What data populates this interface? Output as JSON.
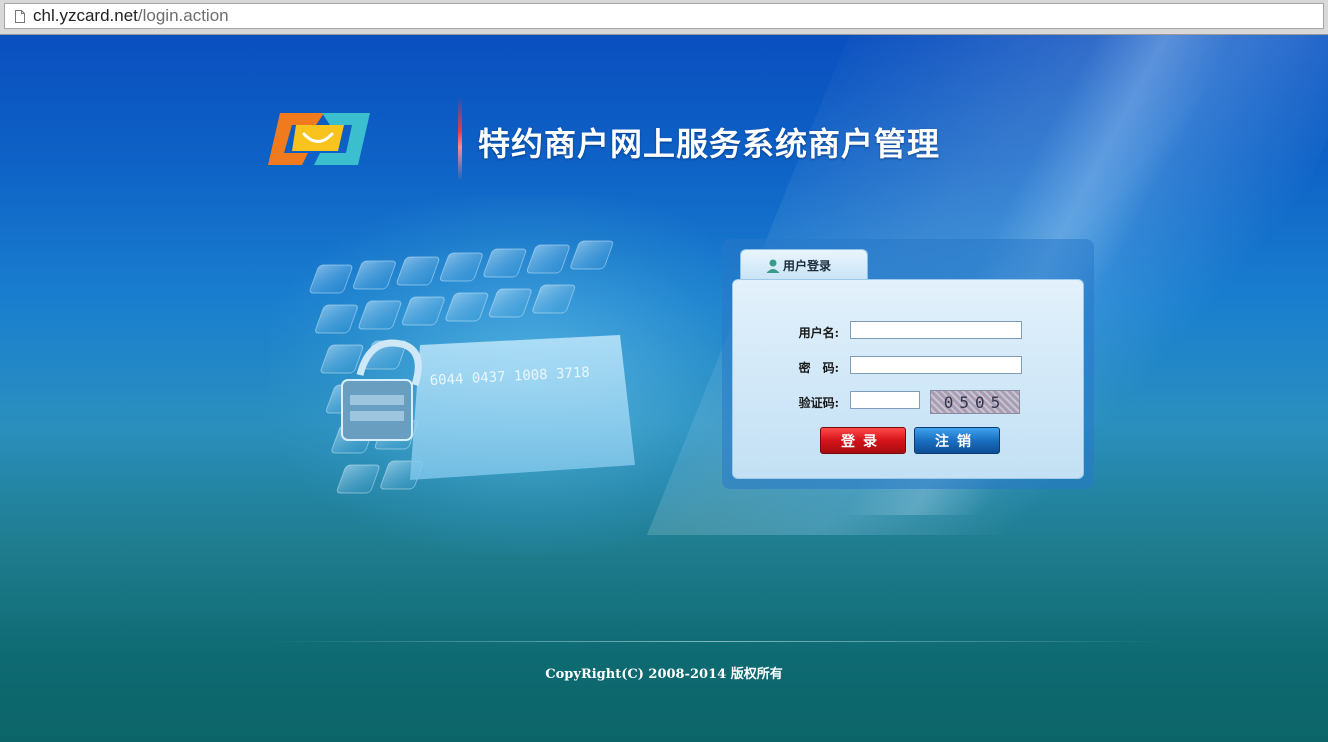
{
  "browser": {
    "url_host": "chl.yzcard.net",
    "url_path": "/login.action"
  },
  "header": {
    "title": "特约商户网上服务系统商户管理"
  },
  "login": {
    "tab_label": "用户登录",
    "username_label": "用户名:",
    "username_value": "",
    "password_label": "密　码:",
    "password_value": "",
    "captcha_label": "验证码:",
    "captcha_value": "",
    "captcha_text": "0505",
    "login_button": "登录",
    "cancel_button": "注销"
  },
  "footer": {
    "copyright": "CopyRight(C) 2008-2014 版权所有"
  },
  "illustration": {
    "card_number": "6044 0437 1008 3718"
  },
  "colors": {
    "login_button": "#d4141a",
    "cancel_button": "#1a6fc0",
    "logo_orange": "#f07a1e",
    "logo_teal": "#3bbfcf",
    "logo_yellow": "#f7c31c"
  },
  "icons": [
    "page-icon",
    "user-icon",
    "padlock-icon"
  ]
}
